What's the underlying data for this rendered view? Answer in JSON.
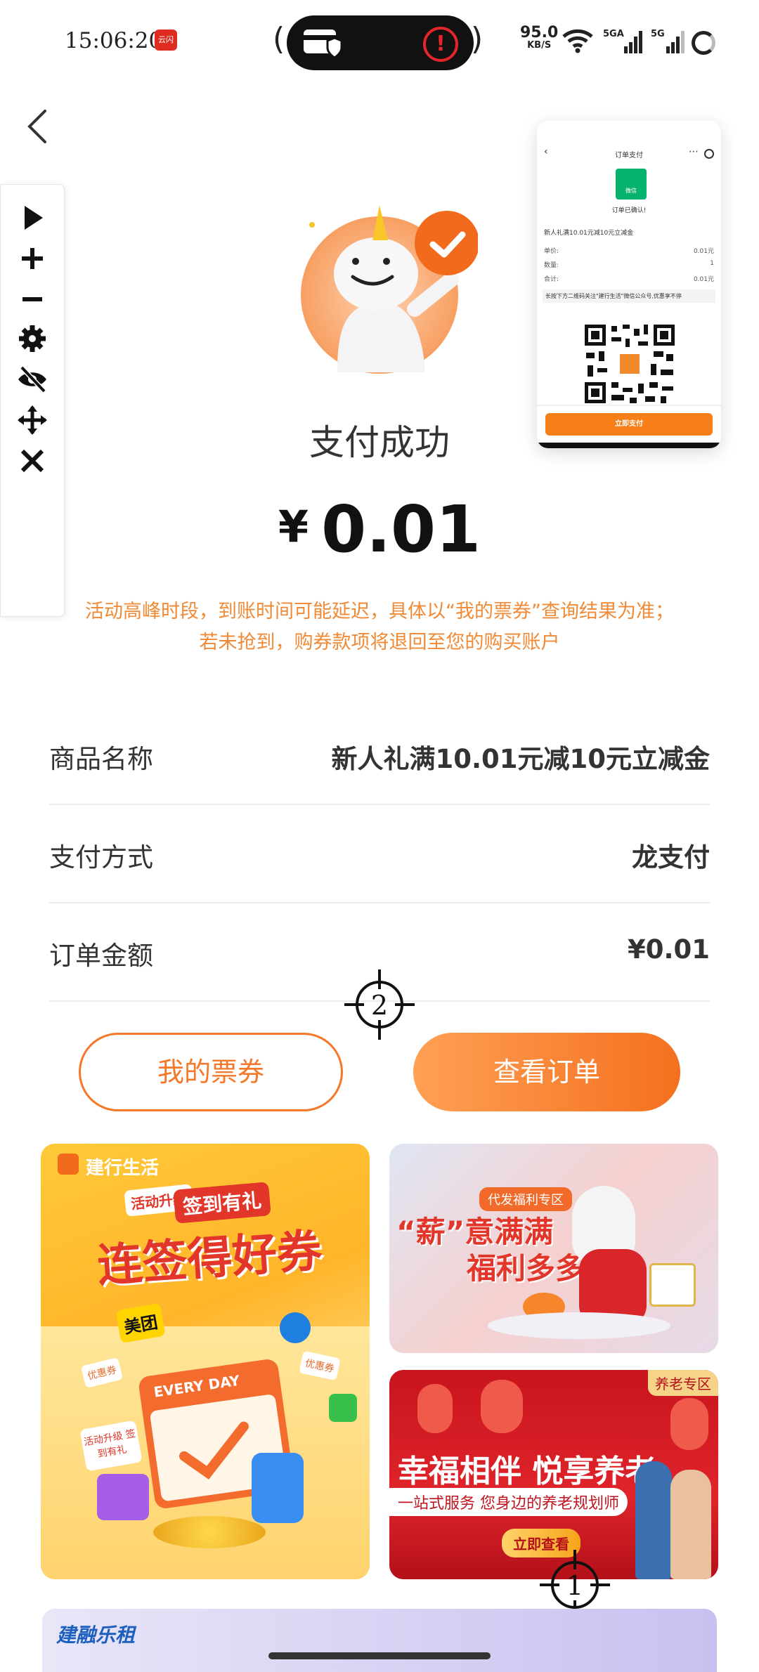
{
  "status_bar": {
    "time": "15:06:20",
    "app_badge": "云闪付",
    "net_speed": "95.0",
    "net_unit": "KB/S",
    "sig1_label": "5GA",
    "sig2_label": "5G"
  },
  "preview": {
    "title": "订单支付",
    "badge": "微信",
    "status": "订单已确认!",
    "product": "新人礼满10.01元减10元立减金",
    "rows": [
      {
        "label": "单价:",
        "value": "0.01元"
      },
      {
        "label": "数量:",
        "value": "1"
      },
      {
        "label": "合计:",
        "value": "0.01元"
      }
    ],
    "tip": "长按下方二维码关注\"建行生活\"微信公众号,优惠享不停",
    "pay_button": "立即支付"
  },
  "result": {
    "title": "支付成功",
    "currency": "¥",
    "amount": "0.01",
    "notice_line1": "活动高峰时段，到账时间可能延迟，具体以“我的票券”查询结果为准；",
    "notice_line2": "若未抢到，购券款项将退回至您的购买账户"
  },
  "details": [
    {
      "label": "商品名称",
      "value": "新人礼满10.01元减10元立减金"
    },
    {
      "label": "支付方式",
      "value": "龙支付"
    },
    {
      "label": "订单金额",
      "value": "¥0.01"
    }
  ],
  "markers": {
    "m1": "1",
    "m2": "2"
  },
  "actions": {
    "tickets": "我的票券",
    "view_order": "查看订单"
  },
  "banners": {
    "left": {
      "brand": "建行生活",
      "tag": "活动升级",
      "headline_small": "签到有礼",
      "headline": "连签得好券",
      "meituan": "美团",
      "every_day": "EVERY DAY",
      "coupon1": "优惠券",
      "coupon2": "优惠券",
      "sticker": "活动升级 签到有礼"
    },
    "right_top": {
      "tag": "代发福利专区",
      "line1": "“薪”意满满",
      "line2": "福利多多"
    },
    "right_bottom": {
      "tag": "养老专区",
      "headline": "幸福相伴 悦享养老",
      "sub": "一站式服务 您身边的养老规划师",
      "cta": "立即查看"
    },
    "bottom": {
      "brand": "建融乐租"
    }
  }
}
